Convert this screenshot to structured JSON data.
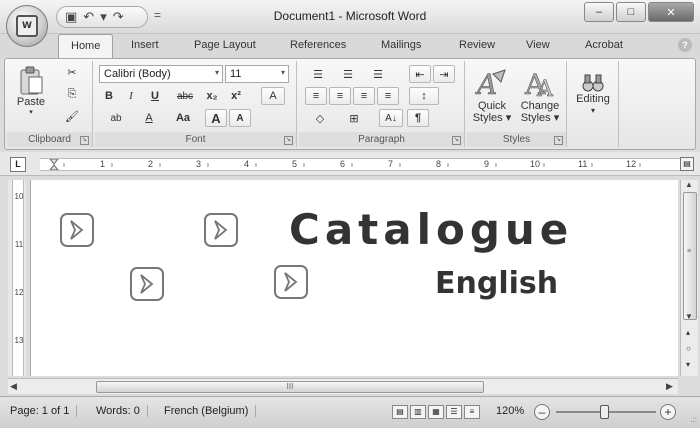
{
  "window": {
    "title": "Document1 - Microsoft Word",
    "office_button_logo": "W",
    "controls": {
      "minimize": "–",
      "maximize": "□",
      "close": "✕"
    }
  },
  "quick_access": {
    "save_icon": "floppy-disk-icon",
    "save_glyph": "▣",
    "undo_glyph": "↶",
    "redo_glyph": "↷",
    "separator": "▾",
    "customize_glyph": "="
  },
  "tabs": [
    {
      "label": "Home",
      "active": true
    },
    {
      "label": "Insert"
    },
    {
      "label": "Page Layout"
    },
    {
      "label": "References"
    },
    {
      "label": "Mailings"
    },
    {
      "label": "Review"
    },
    {
      "label": "View"
    },
    {
      "label": "Acrobat"
    }
  ],
  "help_glyph": "?",
  "ribbon": {
    "clipboard": {
      "label": "Clipboard",
      "paste": "Paste",
      "paste_arrow": "▾",
      "cut_glyph": "✂",
      "copy_glyph": "⎘",
      "format_painter_glyph": "🖌"
    },
    "font": {
      "label": "Font",
      "font_name": "Calibri (Body)",
      "font_size": "11",
      "bold": "B",
      "italic": "I",
      "underline": "U",
      "strike": "abc",
      "subscript": "x₂",
      "superscript": "x²",
      "clear_format": "A",
      "highlight": "ab",
      "font_color": "A",
      "change_case": "Aa",
      "grow": "A",
      "shrink": "A"
    },
    "paragraph": {
      "label": "Paragraph",
      "bullets": "☰",
      "numbering": "☰",
      "multilevel": "☰",
      "decrease_indent": "⇤",
      "increase_indent": "⇥",
      "align_left": "≡",
      "center": "≡",
      "align_right": "≡",
      "justify": "≡",
      "line_spacing": "↕",
      "shading": "◇",
      "borders": "⊞",
      "sort": "A↓",
      "show_marks": "¶"
    },
    "styles": {
      "label": "Styles",
      "quick_styles_line1": "Quick",
      "quick_styles_line2": "Styles",
      "change_styles_line1": "Change",
      "change_styles_line2": "Styles",
      "arrow": "▾"
    },
    "editing": {
      "label_top": "Editing",
      "binoculars": "👓",
      "arrow": "▾"
    },
    "launcher_glyph": "↘"
  },
  "ruler": {
    "corner_glyph": "L",
    "numbers": [
      "1",
      "2",
      "3",
      "4",
      "5",
      "6",
      "7",
      "8",
      "9",
      "10",
      "11",
      "12"
    ],
    "view_ruler_glyph": "▤"
  },
  "vruler_numbers": [
    "10",
    "11",
    "12",
    "13"
  ],
  "document": {
    "heading": "Catalogue",
    "subheading": "English",
    "icon_name": "chevron-right-box-icon"
  },
  "scroll": {
    "up": "▲",
    "down": "▼",
    "left": "◀",
    "right": "▶",
    "grip": "III",
    "prev_page": "▴",
    "browse": "○",
    "next_page": "▾"
  },
  "status": {
    "page": "Page: 1 of 1",
    "words": "Words: 0",
    "language": "French (Belgium)",
    "zoom": "120%",
    "zoom_minus": "–",
    "zoom_plus": "+",
    "grip": ".::"
  }
}
